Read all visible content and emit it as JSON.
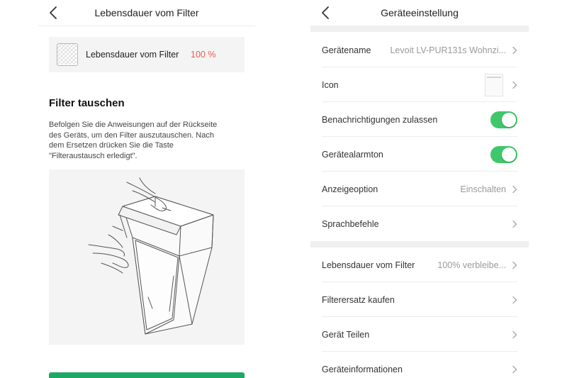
{
  "left": {
    "nav_title": "Lebensdauer vom Filter",
    "filter_card": {
      "label": "Lebensdauer vom Filter",
      "percent": "100 %",
      "percent_color": "#e35d55"
    },
    "section_title": "Filter tauschen",
    "instructions": "Befolgen Sie die Anweisungen auf der Rückseite\ndes Geräts, um den Filter auszutauschen. Nach\ndem Ersetzen drücken Sie die Taste\n\"Filteraustausch erledigt\".",
    "button_color": "#1fa865",
    "icons": {
      "back": "chevron-left-icon",
      "filter": "filter-icon"
    }
  },
  "right": {
    "nav_title": "Geräteeinstellung",
    "rows": [
      {
        "label": "Gerätename",
        "value": "Levoit LV-PUR131s Wohnzi..."
      },
      {
        "label": "Icon",
        "value": ""
      },
      {
        "label": "Benachrichtigungen zulassen",
        "toggle": true
      },
      {
        "label": "Gerätealarmton",
        "toggle": true
      },
      {
        "label": "Anzeigeoption",
        "value": "Einschalten"
      },
      {
        "label": "Sprachbefehle",
        "value": ""
      },
      {
        "label": "Lebensdauer vom Filter",
        "value": "100% verbleibe..."
      },
      {
        "label": "Filterersatz kaufen",
        "value": ""
      },
      {
        "label": "Gerät Teilen",
        "value": ""
      },
      {
        "label": "Geräteinformationen",
        "value": ""
      }
    ],
    "toggle_color": "#3ec86b"
  }
}
